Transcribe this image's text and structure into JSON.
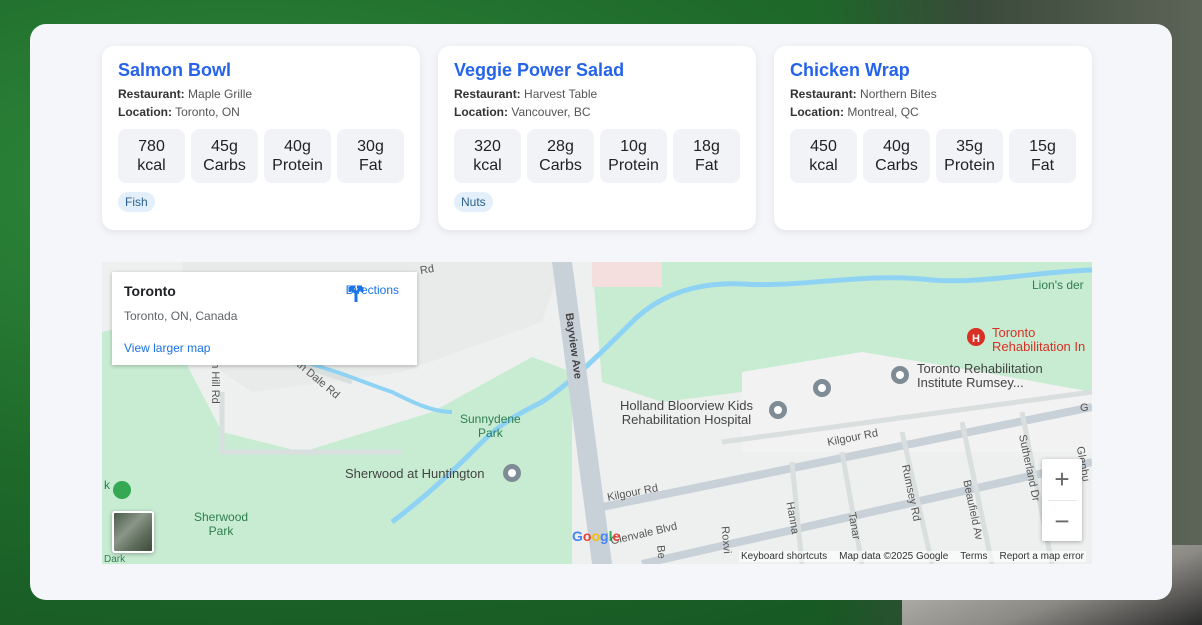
{
  "cards": [
    {
      "title": "Salmon Bowl",
      "restaurant_label": "Restaurant:",
      "restaurant": "Maple Grille",
      "location_label": "Location:",
      "location": "Toronto, ON",
      "nutrition": [
        {
          "value": "780",
          "unit": "kcal"
        },
        {
          "value": "45g",
          "unit": "Carbs"
        },
        {
          "value": "40g",
          "unit": "Protein"
        },
        {
          "value": "30g",
          "unit": "Fat"
        }
      ],
      "tag": "Fish"
    },
    {
      "title": "Veggie Power Salad",
      "restaurant_label": "Restaurant:",
      "restaurant": "Harvest Table",
      "location_label": "Location:",
      "location": "Vancouver, BC",
      "nutrition": [
        {
          "value": "320",
          "unit": "kcal"
        },
        {
          "value": "28g",
          "unit": "Carbs"
        },
        {
          "value": "10g",
          "unit": "Protein"
        },
        {
          "value": "18g",
          "unit": "Fat"
        }
      ],
      "tag": "Nuts"
    },
    {
      "title": "Chicken Wrap",
      "restaurant_label": "Restaurant:",
      "restaurant": "Northern Bites",
      "location_label": "Location:",
      "location": "Montreal, QC",
      "nutrition": [
        {
          "value": "450",
          "unit": "kcal"
        },
        {
          "value": "40g",
          "unit": "Carbs"
        },
        {
          "value": "35g",
          "unit": "Protein"
        },
        {
          "value": "15g",
          "unit": "Fat"
        }
      ],
      "tag": ""
    }
  ],
  "map": {
    "place_title": "Toronto",
    "place_address": "Toronto, ON, Canada",
    "directions_label": "Directions",
    "larger_map_label": "View larger map",
    "zoom_in": "+",
    "zoom_out": "−",
    "logo": "Google",
    "footer": [
      "Keyboard shortcuts",
      "Map data ©2025 Google",
      "Terms",
      "Report a map error"
    ],
    "labels": {
      "sunnydene_park": "Sunnydene\nPark",
      "sherwood_huntington": "Sherwood at Huntington",
      "sherwood_park": "Sherwood\nPark",
      "holland_bloorview": "Holland Bloorview Kids\nRehabilitation Hospital",
      "toronto_rehab": "Toronto\nRehabilitation In",
      "toronto_rehab_rumsey": "Toronto Rehabilitation\nInstitute Rumsey...",
      "lions_den": "Lion's der",
      "bayview_ave": "Bayview Ave",
      "kilgour_rd": "Kilgour Rd",
      "kilgour_rd_2": "Kilgour Rd",
      "glenvale_blvd": "Glenvale Blvd",
      "rumsey_rd": "Rumsey Rd",
      "beaufield_av": "Beaufield Av",
      "sutherland_dr": "Sutherland Dr",
      "dale_rd": "th Dale Rd",
      "hill_rd": "n Hill Rd",
      "top_rd": "Rd",
      "hanna": "Hanna",
      "tanana": "Tanar",
      "roxvill": "Roxvi",
      "glenbu": "Glenbu",
      "park_edge": "Dark",
      "k_edge": "k",
      "be_edge": "Be",
      "g_edge": "G"
    },
    "colors": {
      "park": "#c8ecd2",
      "road": "#ffffff",
      "major_road": "#c8d0d8",
      "water": "#8fd3f4",
      "poi_red": "#d93025"
    }
  }
}
